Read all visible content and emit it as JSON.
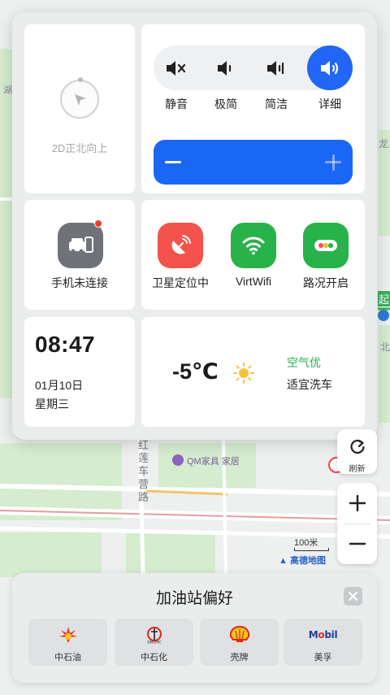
{
  "control_panel": {
    "compass_label": "2D正北向上",
    "volume": {
      "options": [
        {
          "label": "静音",
          "icon": "speaker-mute-icon"
        },
        {
          "label": "极简",
          "icon": "speaker-low-icon"
        },
        {
          "label": "简洁",
          "icon": "speaker-medium-icon"
        },
        {
          "label": "详细",
          "icon": "speaker-high-icon",
          "selected": true
        }
      ],
      "selected_index": 3,
      "slider_level": 1.0
    },
    "phone": {
      "label": "手机未连接",
      "icon": "phone-car-icon",
      "notification": true
    },
    "status_items": [
      {
        "label": "卫星定位中",
        "icon": "satellite-icon",
        "color": "#f4524c"
      },
      {
        "label": "VirtWifi",
        "icon": "wifi-icon",
        "color": "#27b24a"
      },
      {
        "label": "路况开启",
        "icon": "traffic-icon",
        "color": "#27b24a"
      }
    ],
    "clock": {
      "time": "08:47",
      "date": "01月10日",
      "weekday": "星期三"
    },
    "weather": {
      "temperature": "-5℃",
      "icon": "sun-icon",
      "air_quality": "空气优",
      "car_wash": "适宜洗车"
    }
  },
  "map": {
    "poi_label": "QM家具 家居",
    "road_label": "红莲车营路",
    "right_edge_labels": [
      "龙",
      "起",
      "北"
    ],
    "left_edge_label": "湖",
    "scale_label": "100米",
    "logo_text": "高德地图",
    "refresh_label": "刷新"
  },
  "fuel_preference": {
    "title": "加油站偏好",
    "brands": [
      {
        "name": "中石油",
        "logo": "petrochina-logo"
      },
      {
        "name": "中石化",
        "logo": "sinopec-logo"
      },
      {
        "name": "壳牌",
        "logo": "shell-logo"
      },
      {
        "name": "美孚",
        "logo_text": "Mobil"
      }
    ]
  },
  "colors": {
    "accent_blue": "#2266f5",
    "green": "#27b24a",
    "red": "#f4524c",
    "panel_bg": "#ebeded"
  }
}
